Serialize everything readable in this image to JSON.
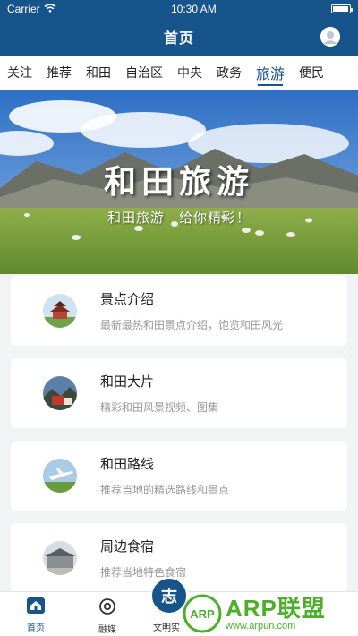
{
  "status": {
    "carrier": "Carrier",
    "time": "10:30 AM",
    "battery_level": 0.95
  },
  "header": {
    "title": "首页"
  },
  "tabs": [
    {
      "label": "关注"
    },
    {
      "label": "推荐"
    },
    {
      "label": "和田"
    },
    {
      "label": "自治区"
    },
    {
      "label": "中央"
    },
    {
      "label": "政务"
    },
    {
      "label": "旅游",
      "active": true
    },
    {
      "label": "便民"
    }
  ],
  "banner": {
    "title": "和田旅游",
    "subtitle": "和田旅游　给你精彩！"
  },
  "cards": [
    {
      "name": "景点介绍",
      "desc": "最新最热和田景点介绍，饱览和田风光",
      "icon": "pagoda-thumbnail"
    },
    {
      "name": "和田大片",
      "desc": "精彩和田风景视频、图集",
      "icon": "landscape-thumbnail"
    },
    {
      "name": "和田路线",
      "desc": "推荐当地的精选路线和景点",
      "icon": "airplane-thumbnail"
    },
    {
      "name": "周边食宿",
      "desc": "推荐当地特色食宿",
      "icon": "lodging-thumbnail"
    }
  ],
  "bottom_nav": {
    "home": "首页",
    "media": "融媒",
    "center_glyph": "志",
    "civilization": "文明实"
  },
  "watermark": {
    "logo": "ARP",
    "brand": "ARP联盟",
    "url": "www.arpun.com"
  },
  "colors": {
    "brand": "#17548c",
    "watermark": "#4caf2a"
  }
}
